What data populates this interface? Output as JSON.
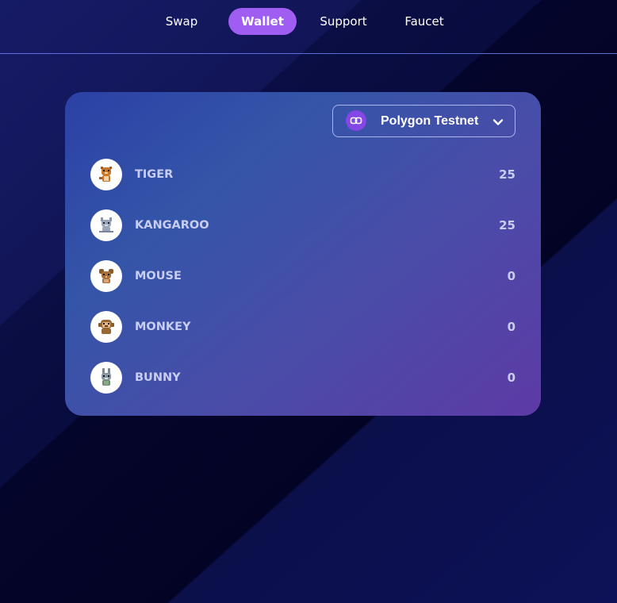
{
  "nav": {
    "items": [
      {
        "label": "Swap",
        "active": false
      },
      {
        "label": "Wallet",
        "active": true
      },
      {
        "label": "Support",
        "active": false
      },
      {
        "label": "Faucet",
        "active": false
      }
    ]
  },
  "wallet": {
    "network": {
      "label": "Polygon Testnet",
      "icon": "polygon-icon",
      "color": "#8247e5"
    },
    "tokens": [
      {
        "name": "TIGER",
        "balance": "25",
        "icon": "tiger-icon"
      },
      {
        "name": "KANGAROO",
        "balance": "25",
        "icon": "kangaroo-icon"
      },
      {
        "name": "MOUSE",
        "balance": "0",
        "icon": "mouse-icon"
      },
      {
        "name": "MONKEY",
        "balance": "0",
        "icon": "monkey-icon"
      },
      {
        "name": "BUNNY",
        "balance": "0",
        "icon": "bunny-icon"
      }
    ]
  },
  "colors": {
    "accent": "#a05df2",
    "background": "#070a35",
    "text_muted": "#c8cdf2"
  }
}
